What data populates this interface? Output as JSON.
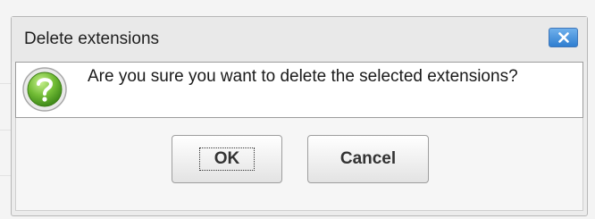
{
  "dialog": {
    "title": "Delete extensions",
    "close_icon": "close-x-icon",
    "message": "Are you sure you want to delete the selected extensions?",
    "icon": "help-question-icon",
    "buttons": {
      "ok_label": "OK",
      "cancel_label": "Cancel"
    }
  },
  "colors": {
    "close_button": "#3c86d6",
    "icon_green": "#5faa2a",
    "border": "#9c9c9c"
  }
}
